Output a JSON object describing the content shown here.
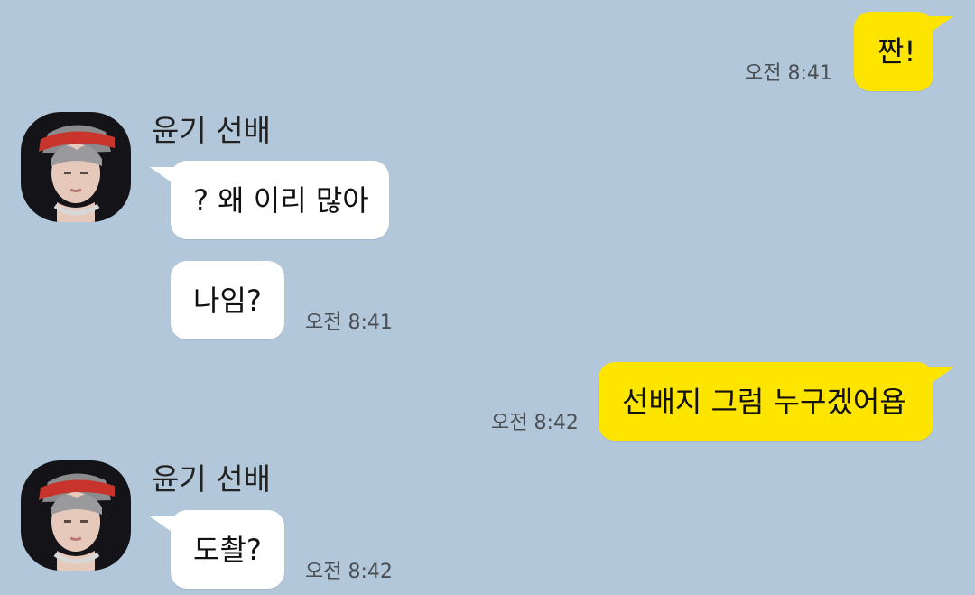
{
  "chat": {
    "messages": [
      {
        "sender": "me",
        "text": "짠!",
        "time": "오전 8:41"
      },
      {
        "sender": "윤기 선배",
        "text": "? 왜 이리 많아"
      },
      {
        "sender": "윤기 선배",
        "text": "나임?",
        "time": "오전 8:41"
      },
      {
        "sender": "me",
        "text": "선배지 그럼 누구겠어욥",
        "time": "오전 8:42"
      },
      {
        "sender": "윤기 선배",
        "text": "도촬?",
        "time": "오전 8:42"
      }
    ],
    "contact_name": "윤기 선배"
  },
  "colors": {
    "background": "#b2c7d9",
    "my_bubble": "#fee500",
    "their_bubble": "#ffffff"
  },
  "icons": {
    "avatar": "profile-photo"
  }
}
